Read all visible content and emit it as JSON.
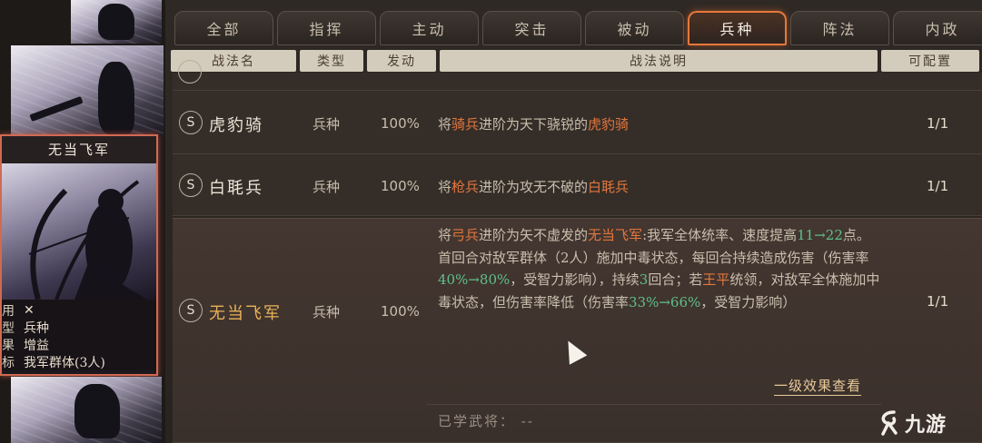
{
  "tabs": [
    {
      "label": "全部",
      "active": false
    },
    {
      "label": "指挥",
      "active": false
    },
    {
      "label": "主动",
      "active": false
    },
    {
      "label": "突击",
      "active": false
    },
    {
      "label": "被动",
      "active": false
    },
    {
      "label": "兵种",
      "active": true
    },
    {
      "label": "阵法",
      "active": false
    },
    {
      "label": "内政",
      "active": false
    }
  ],
  "columns": {
    "name": "战法名",
    "type": "类型",
    "trigger": "发动",
    "description": "战法说明",
    "equippable": "可配置"
  },
  "rows": [
    {
      "grade": "S",
      "name": "虎豹骑",
      "type": "兵种",
      "trigger": "100%",
      "desc": {
        "pre": "将",
        "hl1": "骑兵",
        "mid": "进阶为天下骁锐的",
        "hl2": "虎豹骑"
      },
      "count": "1/1"
    },
    {
      "grade": "S",
      "name": "白毦兵",
      "type": "兵种",
      "trigger": "100%",
      "desc": {
        "pre": "将",
        "hl1": "枪兵",
        "mid": "进阶为攻无不破的",
        "hl2": "白毦兵"
      },
      "count": "1/1"
    },
    {
      "grade": "S",
      "name": "无当飞军",
      "type": "兵种",
      "trigger": "100%",
      "count": "1/1",
      "desc_parts": {
        "p1": "将",
        "o1": "弓兵",
        "p2": "进阶为矢不虚发的",
        "o2": "无当飞军",
        "p3": ":我军全体统率、速度提高",
        "g1": "11→22",
        "p4": "点。首回合对敌军群体（2人）施加中毒状态，每回合持续造成伤害（伤害率",
        "g2": "40%→80%",
        "p5": "，受智力影响），持续",
        "g3": "3",
        "p6": "回合；若",
        "o3": "王平",
        "p7": "统领，对敌军全体施加中毒状态，但伤害率降低（伤害率",
        "g4": "33%→66%",
        "p8": "，受智力影响）"
      },
      "more_link": "一级效果查看",
      "learned": "已学武将：  --"
    }
  ],
  "hero_card": {
    "title": "无当飞军",
    "stats": [
      {
        "key": "用",
        "value": "✕"
      },
      {
        "key": "型",
        "value": "兵种"
      },
      {
        "key": "果",
        "value": "增益"
      },
      {
        "key": "标",
        "value": "我军群体(3人)"
      }
    ]
  },
  "watermark": {
    "logo_text": "九游"
  },
  "colors": {
    "accent_orange": "#e2773d",
    "highlight_green": "#5fc08a",
    "active_tab_border": "#e6783a",
    "gold_name": "#e9b35a"
  }
}
